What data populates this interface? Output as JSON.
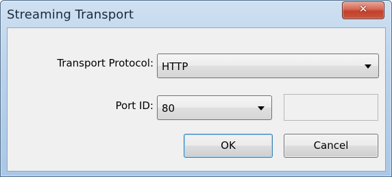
{
  "window": {
    "title": "Streaming Transport",
    "close_icon": "close-x-icon"
  },
  "form": {
    "protocol_label": "Transport Protocol:",
    "protocol_value": "HTTP",
    "port_label": "Port ID:",
    "port_value": "80",
    "port_extra_value": ""
  },
  "buttons": {
    "ok_label": "OK",
    "cancel_label": "Cancel"
  },
  "colors": {
    "title_bar": "#b9d1ea",
    "close_button": "#c8553e",
    "default_button_border": "#3c7fb1"
  }
}
